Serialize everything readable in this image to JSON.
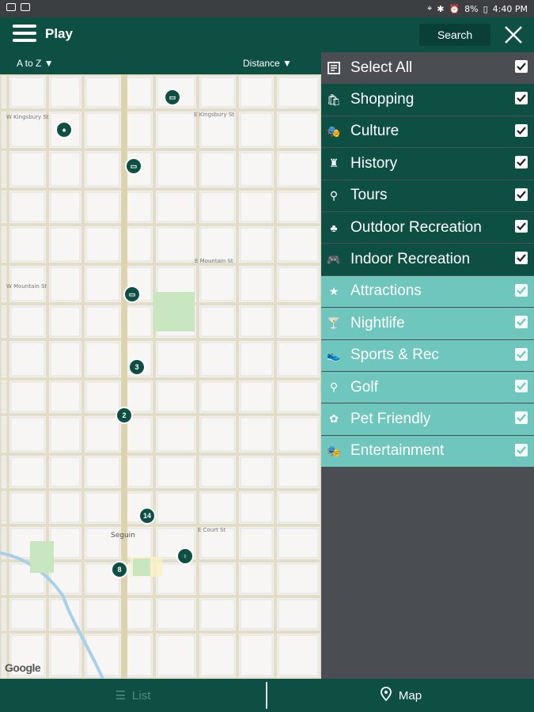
{
  "status": {
    "battery": "8%",
    "time": "4:40 PM"
  },
  "header": {
    "title": "Play",
    "search_label": "Search"
  },
  "sort": {
    "az_label": "A to Z",
    "distance_label": "Distance"
  },
  "map": {
    "streets": [
      "W Kingsbury St",
      "E Kingsbury St",
      "W Mountain St",
      "E Mountain St",
      "E Court St",
      "Seguin"
    ],
    "clusters": [
      {
        "label": "3"
      },
      {
        "label": "2"
      },
      {
        "label": "14"
      },
      {
        "label": "8"
      }
    ],
    "attribution": "Google"
  },
  "filters": {
    "select_all": "Select All",
    "items": [
      {
        "label": "Shopping",
        "icon": "shopping-bag-icon",
        "group": "dark"
      },
      {
        "label": "Culture",
        "icon": "masks-icon",
        "group": "dark"
      },
      {
        "label": "History",
        "icon": "monument-icon",
        "group": "dark"
      },
      {
        "label": "Tours",
        "icon": "tour-pin-icon",
        "group": "dark"
      },
      {
        "label": "Outdoor Recreation",
        "icon": "tree-icon",
        "group": "dark"
      },
      {
        "label": "Indoor Recreation",
        "icon": "gamepad-icon",
        "group": "dark"
      },
      {
        "label": "Attractions",
        "icon": "star-icon",
        "group": "light"
      },
      {
        "label": "Nightlife",
        "icon": "cocktail-icon",
        "group": "light"
      },
      {
        "label": "Sports & Rec",
        "icon": "shoe-icon",
        "group": "light"
      },
      {
        "label": "Golf",
        "icon": "golf-tee-icon",
        "group": "light"
      },
      {
        "label": "Pet Friendly",
        "icon": "paw-icon",
        "group": "light"
      },
      {
        "label": "Entertainment",
        "icon": "masks-icon",
        "group": "light"
      }
    ]
  },
  "tabs": {
    "list_label": "List",
    "map_label": "Map"
  },
  "colors": {
    "primary": "#0e4f43",
    "light_teal": "#6ec6bc",
    "panel_gray": "#4a4e52"
  }
}
